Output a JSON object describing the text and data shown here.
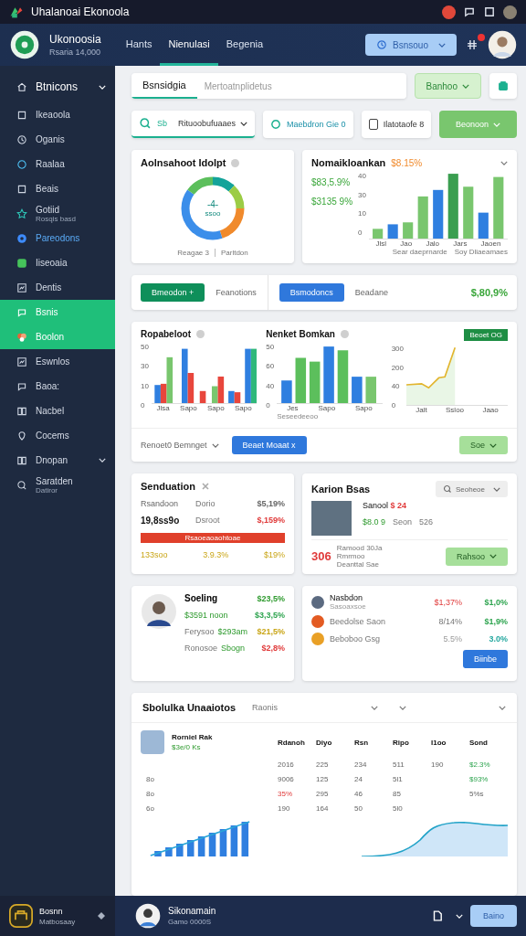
{
  "top_bar": {
    "title": "Uhalanoai Ekonoola"
  },
  "header": {
    "brand": "Ukonoosia",
    "subtitle": "Rsaria 14,000",
    "nav": [
      {
        "label": "Hants",
        "selected": false
      },
      {
        "label": "Nienulasi",
        "selected": true
      },
      {
        "label": "Begenia",
        "selected": false
      }
    ],
    "action": "Bsnsouo",
    "has_badge": true
  },
  "sidebar": {
    "items": [
      {
        "label": "Btnicons",
        "kind": "heading",
        "selected": false,
        "highlighted": false,
        "expandable": true
      },
      {
        "label": "Ikeaoola",
        "kind": "item",
        "selected": false,
        "highlighted": false,
        "expandable": false
      },
      {
        "label": "Oganis",
        "kind": "item",
        "selected": false,
        "highlighted": false,
        "expandable": false
      },
      {
        "label": "Raalaa",
        "kind": "item",
        "selected": false,
        "highlighted": false,
        "expandable": false
      },
      {
        "label": "Beais",
        "kind": "item",
        "selected": false,
        "highlighted": false,
        "expandable": false
      },
      {
        "label": "Gotiid",
        "sublabel": "Rosqis basd",
        "kind": "item",
        "selected": false,
        "highlighted": false,
        "expandable": false
      },
      {
        "label": "Pareodons",
        "kind": "item",
        "selected": false,
        "highlighted": true,
        "expandable": false
      },
      {
        "label": "Iiseoaia",
        "kind": "item",
        "selected": false,
        "highlighted": false,
        "expandable": false
      },
      {
        "label": "Dentis",
        "kind": "item",
        "selected": false,
        "highlighted": false,
        "expandable": false
      },
      {
        "label": "Bsnis",
        "kind": "item",
        "selected": true,
        "highlighted": false,
        "expandable": false
      },
      {
        "label": "Boolon",
        "kind": "item",
        "selected": true,
        "highlighted": false,
        "expandable": false
      },
      {
        "label": "Eswnlos",
        "kind": "item",
        "selected": false,
        "highlighted": false,
        "expandable": false
      },
      {
        "label": "Baoa:",
        "kind": "item",
        "selected": false,
        "highlighted": false,
        "expandable": false
      },
      {
        "label": "Nacbel",
        "kind": "item",
        "selected": false,
        "highlighted": false,
        "expandable": false
      },
      {
        "label": "Cocems",
        "kind": "item",
        "selected": false,
        "highlighted": false,
        "expandable": false
      },
      {
        "label": "Dnopan",
        "kind": "item",
        "selected": false,
        "highlighted": false,
        "expandable": true
      },
      {
        "label": "Saratden",
        "sublabel": "Datiror",
        "kind": "item",
        "selected": false,
        "highlighted": false,
        "expandable": false
      }
    ],
    "footer": {
      "name": "Bosnn",
      "subtitle": "Matbosaay"
    }
  },
  "toolbar": {
    "tab": "Bsnsidgia",
    "placeholder": "Mertoatnplidetus",
    "button": "Banhoo"
  },
  "filters": {
    "search_label": "Sb",
    "dropdown": "Rituoobufuaaes",
    "status": "Maebdron Gie 0",
    "checkbox_label": "Ilatotaofe 8",
    "checked": false,
    "button": "Beonoon"
  },
  "donut_card": {
    "title": "Aolnsahoot Idolpt",
    "center_value": "-4-",
    "center_label": "ssoo",
    "footer": [
      "Reagae 3",
      "Parltdon"
    ]
  },
  "revenue_card": {
    "title": "Nomaikloankan",
    "change": "$8.15%",
    "values": [
      "$83,5.9%",
      "$3135 9%"
    ],
    "y_labels": [
      "40",
      "30",
      "10",
      "0"
    ],
    "x_labels": [
      "Jlsl",
      "Jao",
      "Jalo",
      "Jars",
      "Jaoen"
    ],
    "notes": [
      "Sear daeprnarde",
      "Soy Dliaeamaes"
    ]
  },
  "action_bar": {
    "primary": "Bmeodon +",
    "label_1": "Feanotions",
    "secondary": "Bsmodoncs",
    "label_2": "Beadane",
    "value": "$,80,9%"
  },
  "charts_card": {
    "charts": [
      {
        "kind": "bars",
        "title": "Ropabeloot",
        "y_labels": [
          "50",
          "30",
          "10",
          "0"
        ],
        "x_labels": [
          "Jlsa",
          "Sapo",
          "Sapo",
          "Sapo"
        ]
      },
      {
        "kind": "bars2",
        "title": "Nenket Bomkan",
        "y_labels": [
          "50",
          "60",
          "40",
          "0"
        ],
        "x_labels": [
          "Jes",
          "Sapo",
          "Sapo"
        ],
        "note": "Seseedeeoo"
      },
      {
        "kind": "line",
        "tag": "Beoet OG",
        "y_labels": [
          "300",
          "200",
          "40",
          "0"
        ],
        "x_labels": [
          "Jalt",
          "Ssloo",
          "Jaao"
        ]
      }
    ],
    "footer": {
      "dropdown": "Renoet0 Bemnget",
      "primary": "Beaet Moaat x",
      "secondary": "Soe"
    }
  },
  "summary_card": {
    "title": "Senduation",
    "rows": [
      {
        "label": "Rsandoon",
        "name": "Dorio",
        "value": "$5,19%",
        "kind": "muted"
      },
      {
        "label": "19,8ss9o",
        "name": "Dsroot",
        "value": "$,159%",
        "kind": "down"
      }
    ],
    "progress": {
      "label": "Rsaoeaoaohtoae",
      "level": 1
    },
    "totals": [
      "133soo",
      "3.9.3%",
      "$19%"
    ]
  },
  "profile_card": {
    "title": "Karion Bsas",
    "search": "Seoheoe",
    "name": "Sanool",
    "price": "$ 24",
    "stats": [
      "$8.0 9",
      "Seon",
      "526"
    ],
    "count": "306",
    "lines": [
      "Ramood 30Ja",
      "Rmrmoo",
      "Deanttal Sae"
    ],
    "button": "Rahsoo"
  },
  "person_card": {
    "name": "Soeling",
    "value": "$23,5%",
    "rows": [
      {
        "sub": "$3591 noon",
        "value": "$3,3,5%",
        "kind": "up"
      },
      {
        "label": "Ferysoo",
        "sub": "$293am",
        "value": "$21,5%",
        "kind": "warn"
      },
      {
        "label": "Ronosoe",
        "sub": "Sbogn",
        "value": "$2,8%",
        "kind": "down"
      }
    ]
  },
  "list_card": {
    "items": [
      {
        "name": "Nasbdon",
        "sub": "Sasoaxsoe",
        "change": {
          "text": "$1,37%",
          "kind": "down"
        },
        "value": {
          "text": "$1,0%",
          "kind": "up"
        }
      },
      {
        "name": "Beedolse Saon",
        "change": {
          "text": "8/14%",
          "kind": "flat"
        },
        "value": {
          "text": "$1,9%",
          "kind": "up"
        }
      },
      {
        "name": "Beboboo Gsg",
        "change": {
          "text": "5.5%",
          "kind": "faint"
        },
        "value": {
          "text": "3.0%",
          "kind": "teal"
        }
      }
    ],
    "button": "Biinbe"
  },
  "table_card": {
    "title": "Sbolulka Unaaiotos",
    "filter": "Raonis",
    "product": {
      "name": "Rorniel Rak",
      "sub": "$3e/0 Ks"
    },
    "columns": [
      "Rdanoh",
      "Diyo",
      "Rsn",
      "Ripo",
      "I1oo",
      "Sond"
    ],
    "rows": [
      {
        "cells": [
          "2016",
          "225",
          "234",
          "511",
          "190",
          {
            "text": "$2.3%",
            "kind": "up"
          }
        ]
      },
      {
        "label": "8o",
        "cells": [
          "9006",
          "125",
          "24",
          "5l1",
          null,
          {
            "text": "$93%",
            "kind": "up"
          }
        ]
      },
      {
        "label": "8o",
        "cells": [
          {
            "text": "35%",
            "kind": "down"
          },
          "295",
          "46",
          "85",
          null,
          "5%s"
        ]
      },
      {
        "label": "6o",
        "cells": [
          "190",
          "164",
          "50",
          "5l0",
          null,
          null
        ]
      }
    ]
  },
  "bottom_bar": {
    "user": "Sikonamain",
    "subtitle": "Gamo 0000S",
    "button": "Baino"
  }
}
